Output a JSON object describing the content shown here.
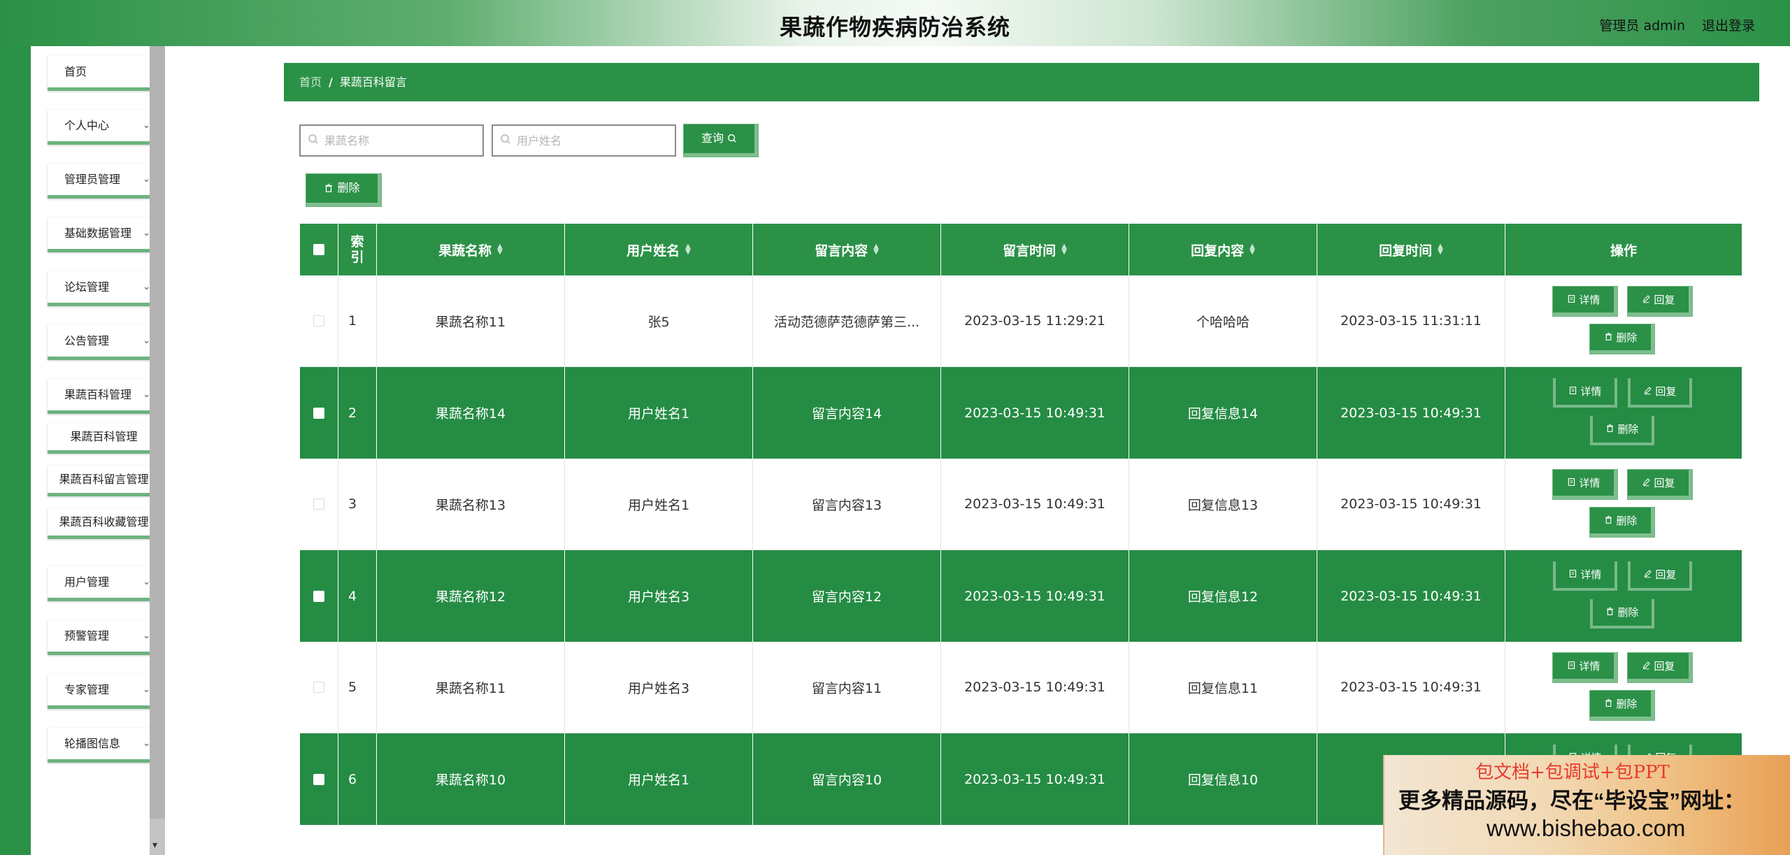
{
  "header": {
    "title": "果蔬作物疾病防治系统",
    "user": "管理员 admin",
    "logout": "退出登录"
  },
  "sidebar": {
    "items": [
      {
        "label": "首页"
      },
      {
        "label": "个人中心"
      },
      {
        "label": "管理员管理"
      },
      {
        "label": "基础数据管理"
      },
      {
        "label": "论坛管理"
      },
      {
        "label": "公告管理"
      },
      {
        "label": "果蔬百科管理"
      },
      {
        "label": "用户管理"
      },
      {
        "label": "预警管理"
      },
      {
        "label": "专家管理"
      },
      {
        "label": "轮播图信息"
      }
    ],
    "sub_items": [
      {
        "label": "果蔬百科管理"
      },
      {
        "label": "果蔬百科留言管理"
      },
      {
        "label": "果蔬百科收藏管理"
      }
    ]
  },
  "breadcrumb": {
    "home": "首页",
    "separator": "/",
    "current": "果蔬百科留言"
  },
  "search": {
    "name_placeholder": "果蔬名称",
    "user_placeholder": "用户姓名",
    "query_label": "查询"
  },
  "toolbar": {
    "delete_label": "删除"
  },
  "table": {
    "headers": {
      "index_1": "索",
      "index_2": "引",
      "name": "果蔬名称",
      "user": "用户姓名",
      "content": "留言内容",
      "time": "留言时间",
      "reply": "回复内容",
      "reply_time": "回复时间",
      "ops": "操作"
    },
    "actions": {
      "detail": "详情",
      "reply": "回复",
      "delete": "删除"
    },
    "rows": [
      {
        "index": "1",
        "name": "果蔬名称11",
        "user": "张5",
        "content": "活动范德萨范德萨第三...",
        "time": "2023-03-15 11:29:21",
        "reply": "个哈哈哈",
        "reply_time": "2023-03-15 11:31:11"
      },
      {
        "index": "2",
        "name": "果蔬名称14",
        "user": "用户姓名1",
        "content": "留言内容14",
        "time": "2023-03-15 10:49:31",
        "reply": "回复信息14",
        "reply_time": "2023-03-15 10:49:31"
      },
      {
        "index": "3",
        "name": "果蔬名称13",
        "user": "用户姓名1",
        "content": "留言内容13",
        "time": "2023-03-15 10:49:31",
        "reply": "回复信息13",
        "reply_time": "2023-03-15 10:49:31"
      },
      {
        "index": "4",
        "name": "果蔬名称12",
        "user": "用户姓名3",
        "content": "留言内容12",
        "time": "2023-03-15 10:49:31",
        "reply": "回复信息12",
        "reply_time": "2023-03-15 10:49:31"
      },
      {
        "index": "5",
        "name": "果蔬名称11",
        "user": "用户姓名3",
        "content": "留言内容11",
        "time": "2023-03-15 10:49:31",
        "reply": "回复信息11",
        "reply_time": "2023-03-15 10:49:31"
      },
      {
        "index": "6",
        "name": "果蔬名称10",
        "user": "用户姓名1",
        "content": "留言内容10",
        "time": "2023-03-15 10:49:31",
        "reply": "回复信息10",
        "reply_time": "2023"
      }
    ]
  },
  "watermark": {
    "line1": "包文档+包调试+包PPT",
    "line2": "更多精品源码，尽在“毕设宝”网址：",
    "line3": "www.bishebao.com"
  },
  "colors": {
    "primary": "#2b9147",
    "row_green": "#258c44",
    "accent_border": "#7fbe8e"
  }
}
